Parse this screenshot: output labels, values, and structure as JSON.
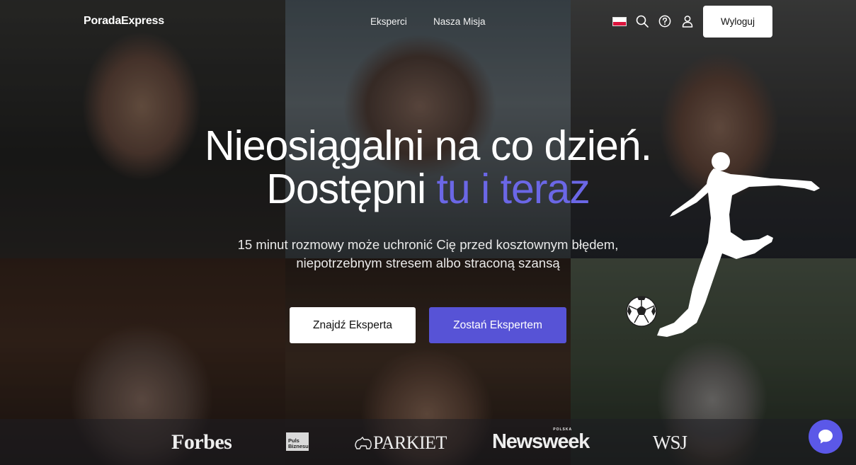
{
  "nav": {
    "brand": "PoradaExpress",
    "links": [
      "Eksperci",
      "Nasza Misja"
    ],
    "language_flag": "poland-flag-icon",
    "icons": [
      "search-icon",
      "help-icon",
      "user-icon"
    ],
    "logout_label": "Wyloguj"
  },
  "hero": {
    "title_line1": "Nieosiągalni na co dzień.",
    "title_line2_plain": "Dostępni",
    "title_line2_accent": "tu i teraz",
    "subtitle_line1": "15 minut rozmowy może uchronić Cię przed kosztownym błędem,",
    "subtitle_line2": "niepotrzebnym stresem albo straconą szansą",
    "find_expert_label": "Znajdź Eksperta",
    "become_expert_label": "Zostań Ekspertem"
  },
  "press": {
    "forbes": "Forbes",
    "puls_line1": "Puls",
    "puls_line2": "Biznesu",
    "parkiet": "PARKIET",
    "newsweek": "Newsweek",
    "newsweek_sub": "POLSKA",
    "wsj": "WSJ"
  },
  "colors": {
    "accent": "#6b67e6",
    "primary_button": "#5753d6",
    "chat_button": "#5b58e8"
  },
  "chat": {
    "icon": "chat-bubble-icon"
  }
}
